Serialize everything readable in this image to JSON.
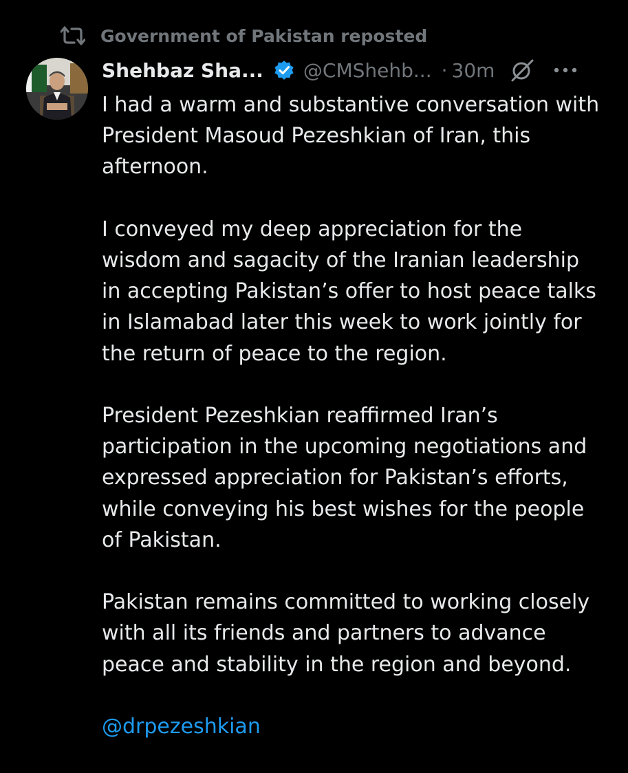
{
  "repost": {
    "label": "Government of Pakistan reposted",
    "icon": "repost-icon"
  },
  "author": {
    "display_name": "Shehbaz Sha...",
    "handle": "@CMShehb...",
    "separator": "·",
    "time": "30m",
    "verified_icon": "verified-badge-icon",
    "verified_color": "#1d9bf0"
  },
  "tweet": {
    "paragraphs": [
      "I had a warm and substantive conversation with\nPresident  Masoud Pezeshkian of Iran, this\nafternoon.",
      "I conveyed my deep appreciation for the\nwisdom and sagacity of the Iranian leadership\nin accepting Pakistan’s offer to host peace talks\nin Islamabad later this week to work jointly for\nthe return of peace to the region.",
      "President Pezeshkian reaffirmed Iran’s\nparticipation in the upcoming negotiations and\nexpressed appreciation for Pakistan’s efforts,\nwhile conveying his best wishes for the people\nof Pakistan.",
      "Pakistan remains committed to working closely\nwith all its friends and partners to advance\npeace and stability in the region and beyond."
    ],
    "mention": "@drpezeshkian"
  },
  "colors": {
    "background": "#000000",
    "text": "#e7e9ea",
    "muted": "#71767b",
    "link": "#1d9bf0"
  }
}
